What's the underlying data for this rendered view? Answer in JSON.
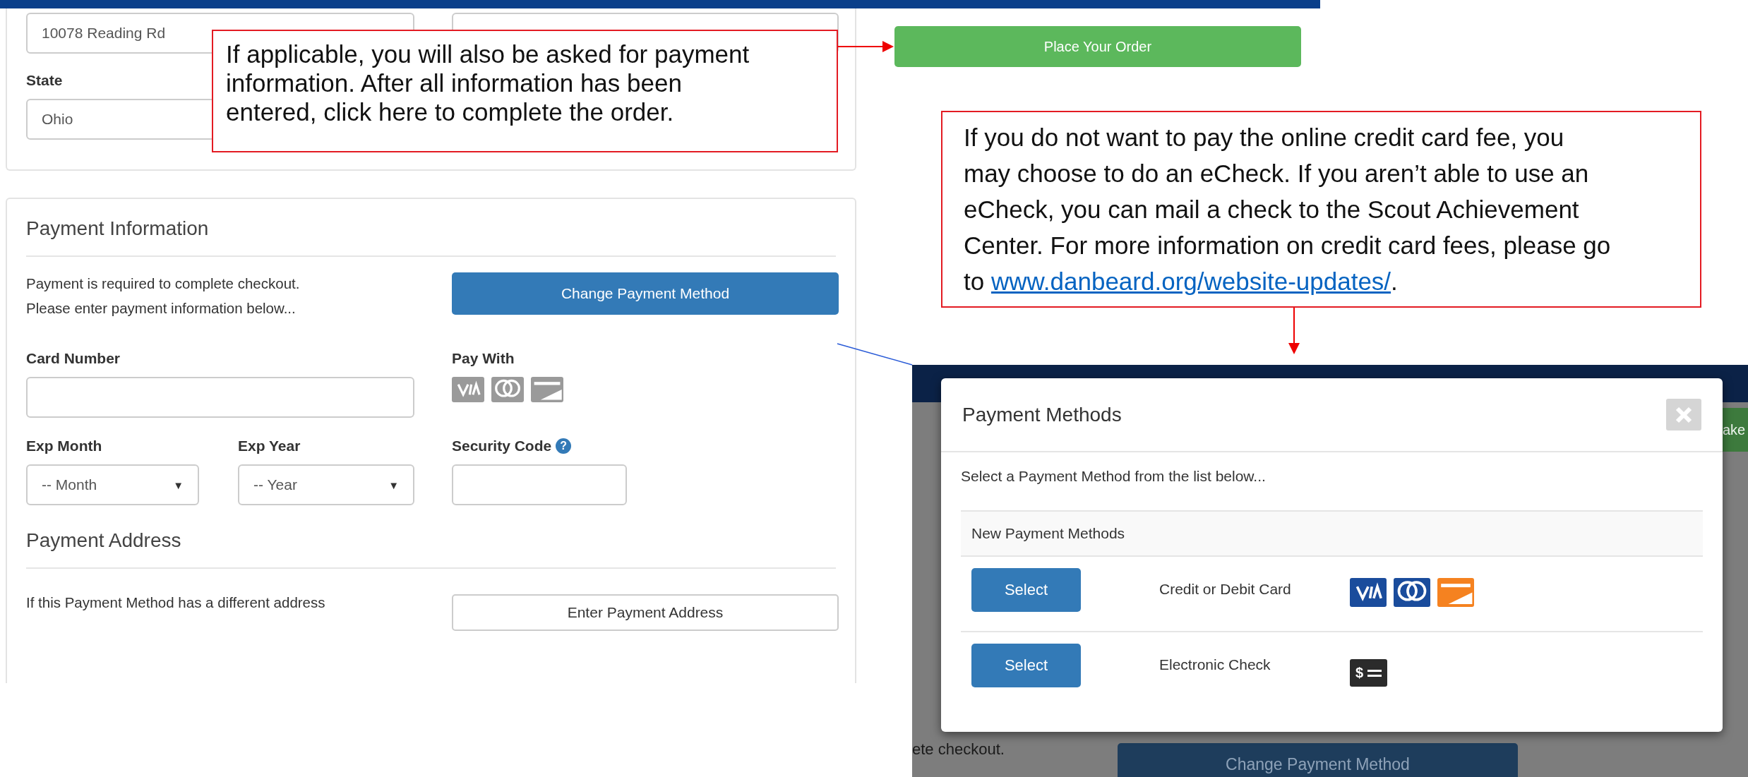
{
  "address_card": {
    "street_field": {
      "value": "10078 Reading Rd"
    },
    "state_label": "State",
    "state_field": {
      "value": "Ohio"
    }
  },
  "callouts": [
    {
      "text": "If applicable, you will also be asked for payment information. After all information has been entered, click here to complete the order."
    },
    {
      "text": "If you do not want to pay the online credit card fee, you may choose to do an eCheck. If you aren’t able to use an eCheck, you can mail a check to the Scout Achievement Center. For more information on credit card fees, please go to ",
      "link": "www.danbeard.org/website-updates/",
      "after": "."
    }
  ],
  "place_order_button": "Place Your Order",
  "payment_card": {
    "title": "Payment Information",
    "notice": [
      "Payment is required to complete checkout.",
      "Please enter payment information below..."
    ],
    "change_button": "Change Payment Method",
    "card_number_label": "Card Number",
    "pay_with_label": "Pay With",
    "cards_active": false,
    "exp_month_label": "Exp Month",
    "exp_month": "-- Month",
    "exp_year_label": "Exp Year",
    "exp_year": "-- Year",
    "dropdown_glyph": "▼",
    "security_label": "Security Code",
    "help_glyph": "?",
    "address_title": "Payment Address",
    "address_text": "If this Payment Method has a different address",
    "address_button": "Enter Payment Address"
  },
  "modal_screenshot": {
    "behind_button": "ake",
    "behind_text": "ete checkout.",
    "behind_change_button": "Change Payment Method",
    "modal": {
      "title": "Payment Methods",
      "intro": "Select a Payment Method from the list below...",
      "table_header": "New Payment Methods",
      "methods": [
        {
          "kind": "card",
          "button": "Select",
          "name": "Credit or Debit Card",
          "cards_active": true
        },
        {
          "kind": "check",
          "button": "Select",
          "name": "Electronic Check",
          "icon_glyph": "$"
        }
      ]
    }
  }
}
